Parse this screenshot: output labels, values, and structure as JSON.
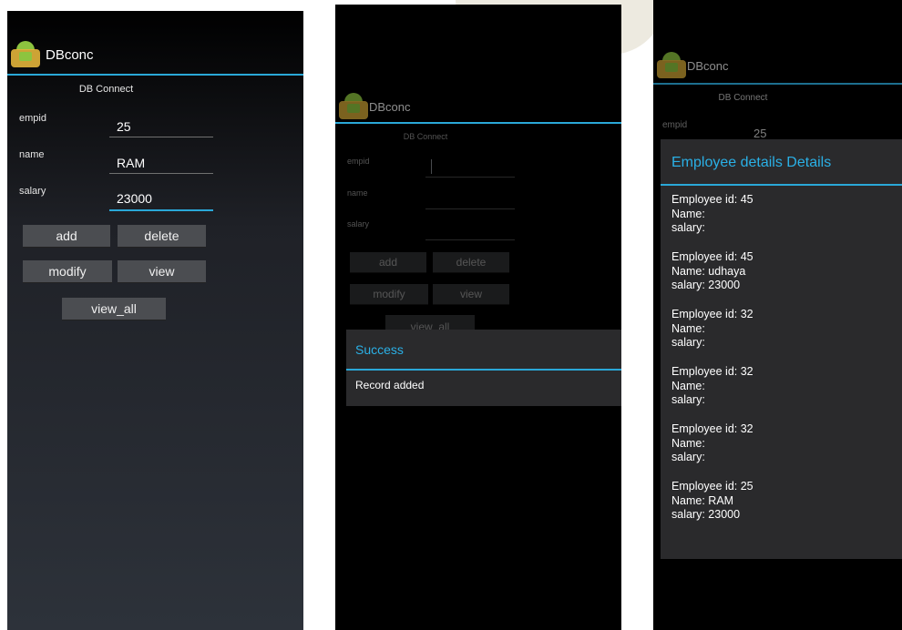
{
  "app": {
    "title": "DBconc",
    "header": "DB Connect"
  },
  "labels": {
    "empid": "empid",
    "name": "name",
    "salary": "salary"
  },
  "buttons": {
    "add": "add",
    "delete": "delete",
    "modify": "modify",
    "view": "view",
    "view_all": "view_all"
  },
  "screen1": {
    "empid_value": "25",
    "name_value": "RAM",
    "salary_value": "23000"
  },
  "screen2": {
    "dialog_title": "Success",
    "dialog_message": "Record added"
  },
  "screen3": {
    "empid_value": "25",
    "dialog_title": "Employee details Details",
    "records": [
      {
        "line1": "Employee id: 45",
        "line2": "Name:",
        "line3": "salary:"
      },
      {
        "line1": "Employee id: 45",
        "line2": "Name: udhaya",
        "line3": "salary: 23000"
      },
      {
        "line1": "Employee id: 32",
        "line2": "Name:",
        "line3": "salary:"
      },
      {
        "line1": "Employee id: 32",
        "line2": "Name:",
        "line3": "salary:"
      },
      {
        "line1": "Employee id: 32",
        "line2": "Name:",
        "line3": "salary:"
      },
      {
        "line1": "Employee id: 25",
        "line2": "Name: RAM",
        "line3": "salary: 23000"
      }
    ]
  },
  "colors": {
    "accent": "#2aa8d8",
    "dialog_title": "#2ab0e6",
    "button": "#4b4d51",
    "dialog_bg": "#2a2a2c"
  },
  "icons": [
    "android-app-icon"
  ]
}
